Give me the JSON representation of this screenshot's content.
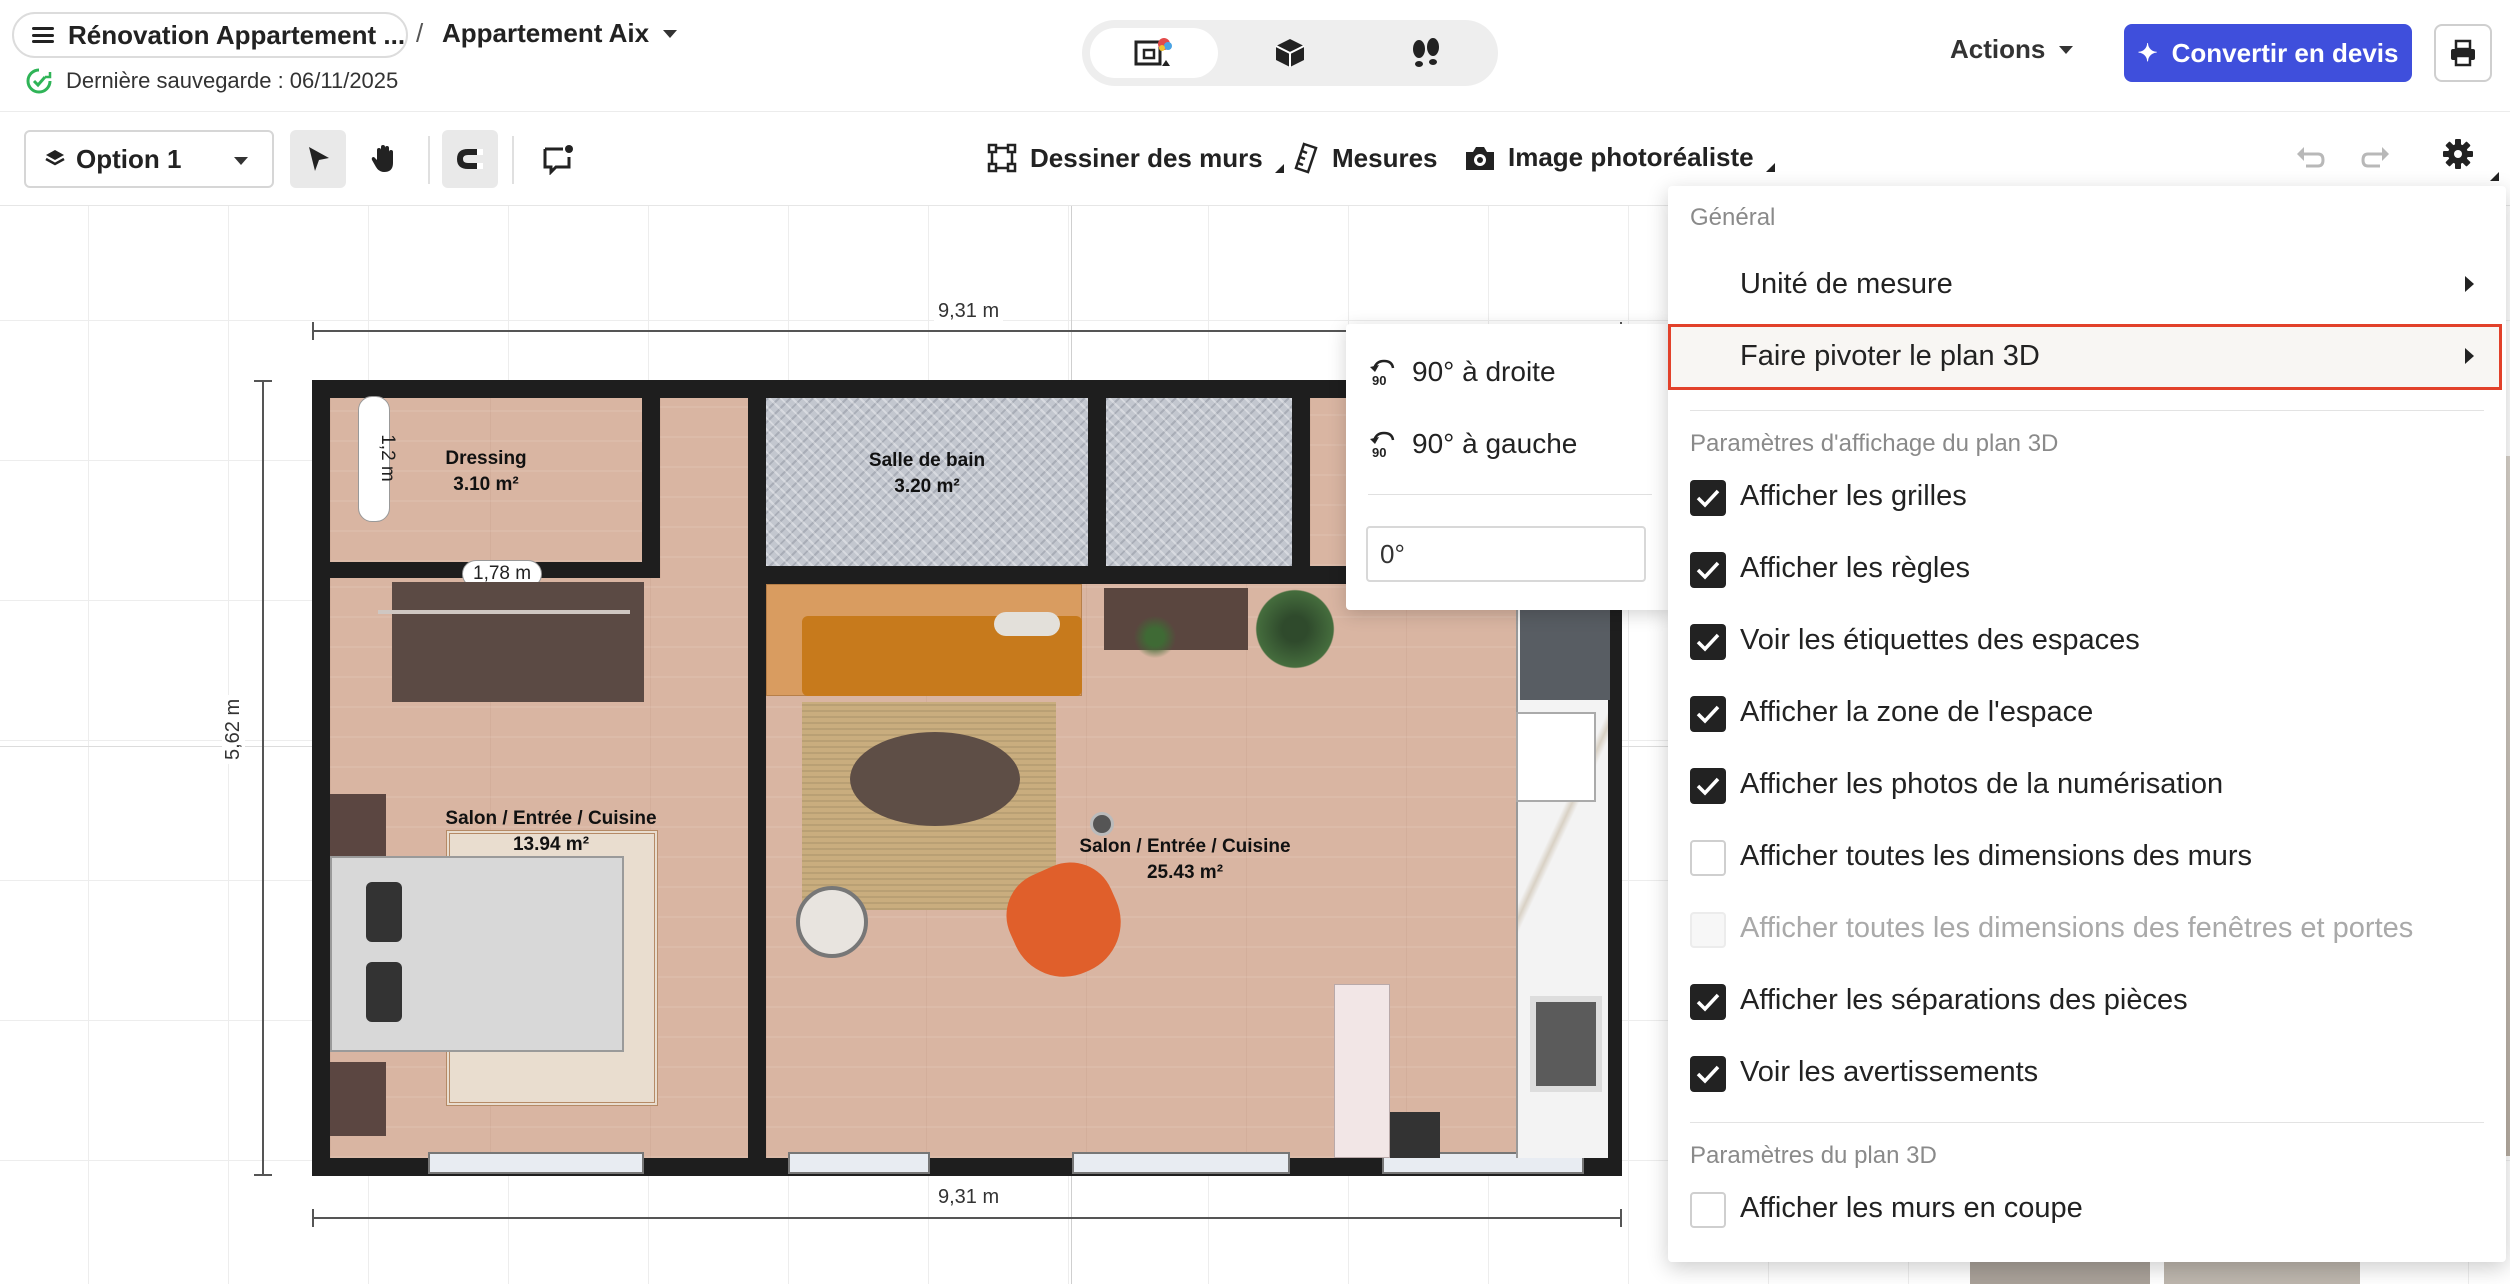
{
  "header": {
    "project_name": "Rénovation Appartement ...",
    "separator": "/",
    "variant": "Appartement Aix",
    "last_saved": "Dernière sauvegarde : 06/11/2025",
    "view_modes": [
      "plan-2d-icon",
      "view-3d-icon",
      "walk-icon"
    ],
    "actions_label": "Actions",
    "convert_label": "Convertir en devis"
  },
  "toolbar": {
    "option_label": "Option 1",
    "draw_walls": "Dessiner des murs",
    "measures": "Mesures",
    "photo": "Image photoréaliste"
  },
  "plan": {
    "top_dimension": "9,31 m",
    "bottom_dimension": "9,31 m",
    "left_dimension": "5,62 m",
    "dim_pill_vertical": "1,2 m",
    "dim_pill_horizontal": "1,78 m",
    "rooms": [
      {
        "name": "Dressing",
        "area": "3.10 m²"
      },
      {
        "name": "Salle de bain",
        "area": "3.20 m²"
      },
      {
        "name": "Salon / Entrée / Cuisine",
        "area": "13.94 m²"
      },
      {
        "name": "Salon / Entrée / Cuisine",
        "area": "25.43 m²"
      }
    ]
  },
  "rotate_submenu": {
    "right": "90° à droite",
    "left": "90° à gauche",
    "angle_value": "0°"
  },
  "settings_menu": {
    "section_general": "Général",
    "unit": "Unité de mesure",
    "rotate": "Faire pivoter le plan 3D",
    "section_display": "Paramètres d'affichage du plan 3D",
    "options": [
      {
        "label": "Afficher les grilles",
        "checked": true
      },
      {
        "label": "Afficher les règles",
        "checked": true
      },
      {
        "label": "Voir les étiquettes des espaces",
        "checked": true
      },
      {
        "label": "Afficher la zone de l'espace",
        "checked": true
      },
      {
        "label": "Afficher les photos de la numérisation",
        "checked": true
      },
      {
        "label": "Afficher toutes les dimensions des murs",
        "checked": false
      },
      {
        "label": "Afficher toutes les dimensions des fenêtres et portes",
        "checked": false,
        "disabled": true
      },
      {
        "label": "Afficher les séparations des pièces",
        "checked": true
      },
      {
        "label": "Voir les avertissements",
        "checked": true
      }
    ],
    "section_3d": "Paramètres du plan 3D",
    "cut_walls": {
      "label": "Afficher les murs en coupe",
      "checked": false
    }
  },
  "colors": {
    "accent": "#3f4fdc",
    "highlight_border": "#e2412a",
    "save_ok": "#2fb457"
  }
}
